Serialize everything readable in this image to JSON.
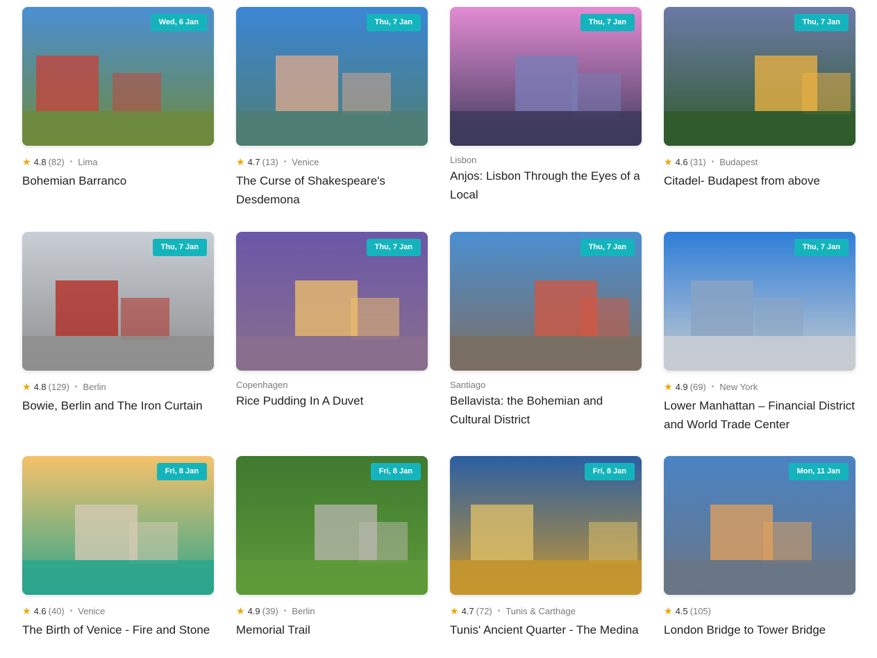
{
  "cards": [
    {
      "date": "Wed, 6 Jan",
      "rating": "4.8",
      "count": "(82)",
      "city": "Lima",
      "title": "Bohemian Barranco",
      "sky": "#4a8fd4",
      "ground": "#6f8a3c",
      "accent": "#c9413a"
    },
    {
      "date": "Thu, 7 Jan",
      "rating": "4.7",
      "count": "(13)",
      "city": "Venice",
      "title": "The Curse of Shakespeare's Desdemona",
      "sky": "#3b86d6",
      "ground": "#4f7d72",
      "accent": "#e0a98f"
    },
    {
      "date": "Thu, 7 Jan",
      "rating": "",
      "count": "",
      "city": "Lisbon",
      "title": "Anjos: Lisbon Through the Eyes of a Local",
      "sky": "#e38bd3",
      "ground": "#3d3a5c",
      "accent": "#7a7fb8"
    },
    {
      "date": "Thu, 7 Jan",
      "rating": "4.6",
      "count": "(31)",
      "city": "Budapest",
      "title": "Citadel- Budapest from above",
      "sky": "#6c7aa8",
      "ground": "#2f5a2a",
      "accent": "#f2b441"
    },
    {
      "date": "Thu, 7 Jan",
      "rating": "4.8",
      "count": "(129)",
      "city": "Berlin",
      "title": "Bowie, Berlin and The Iron Curtain",
      "sky": "#c9cfd6",
      "ground": "#8e8e8e",
      "accent": "#b3261e"
    },
    {
      "date": "Thu, 7 Jan",
      "rating": "",
      "count": "",
      "city": "Copenhagen",
      "title": "Rice Pudding In A Duvet",
      "sky": "#6a57a8",
      "ground": "#8a6f8e",
      "accent": "#f1c16a"
    },
    {
      "date": "Thu, 7 Jan",
      "rating": "",
      "count": "",
      "city": "Santiago",
      "title": "Bellavista: the Bohemian and Cultural District",
      "sky": "#4b8fd2",
      "ground": "#7b6e62",
      "accent": "#d4563f"
    },
    {
      "date": "Thu, 7 Jan",
      "rating": "4.9",
      "count": "(69)",
      "city": "New York",
      "title": "Lower Manhattan – Financial District and World Trade Center",
      "sky": "#2e7ed8",
      "ground": "#c8ccd2",
      "accent": "#8aa3c0"
    },
    {
      "date": "Fri, 8 Jan",
      "rating": "4.6",
      "count": "(40)",
      "city": "Venice",
      "title": "The Birth of Venice - Fire and Stone",
      "sky": "#f6c26b",
      "ground": "#2aa58c",
      "accent": "#d8cbb5"
    },
    {
      "date": "Fri, 8 Jan",
      "rating": "4.9",
      "count": "(39)",
      "city": "Berlin",
      "title": "Memorial Trail",
      "sky": "#3f7a2f",
      "ground": "#5f9a3a",
      "accent": "#b9b7b0"
    },
    {
      "date": "Fri, 8 Jan",
      "rating": "4.7",
      "count": "(72)",
      "city": "Tunis & Carthage",
      "title": "Tunis' Ancient Quarter - The Medina",
      "sky": "#2b5fa3",
      "ground": "#c7962e",
      "accent": "#e1c36a"
    },
    {
      "date": "Mon, 11 Jan",
      "rating": "4.5",
      "count": "(105)",
      "city": "",
      "title": "London Bridge to Tower Bridge",
      "sky": "#4a83c4",
      "ground": "#6a7684",
      "accent": "#e4a25b"
    }
  ]
}
